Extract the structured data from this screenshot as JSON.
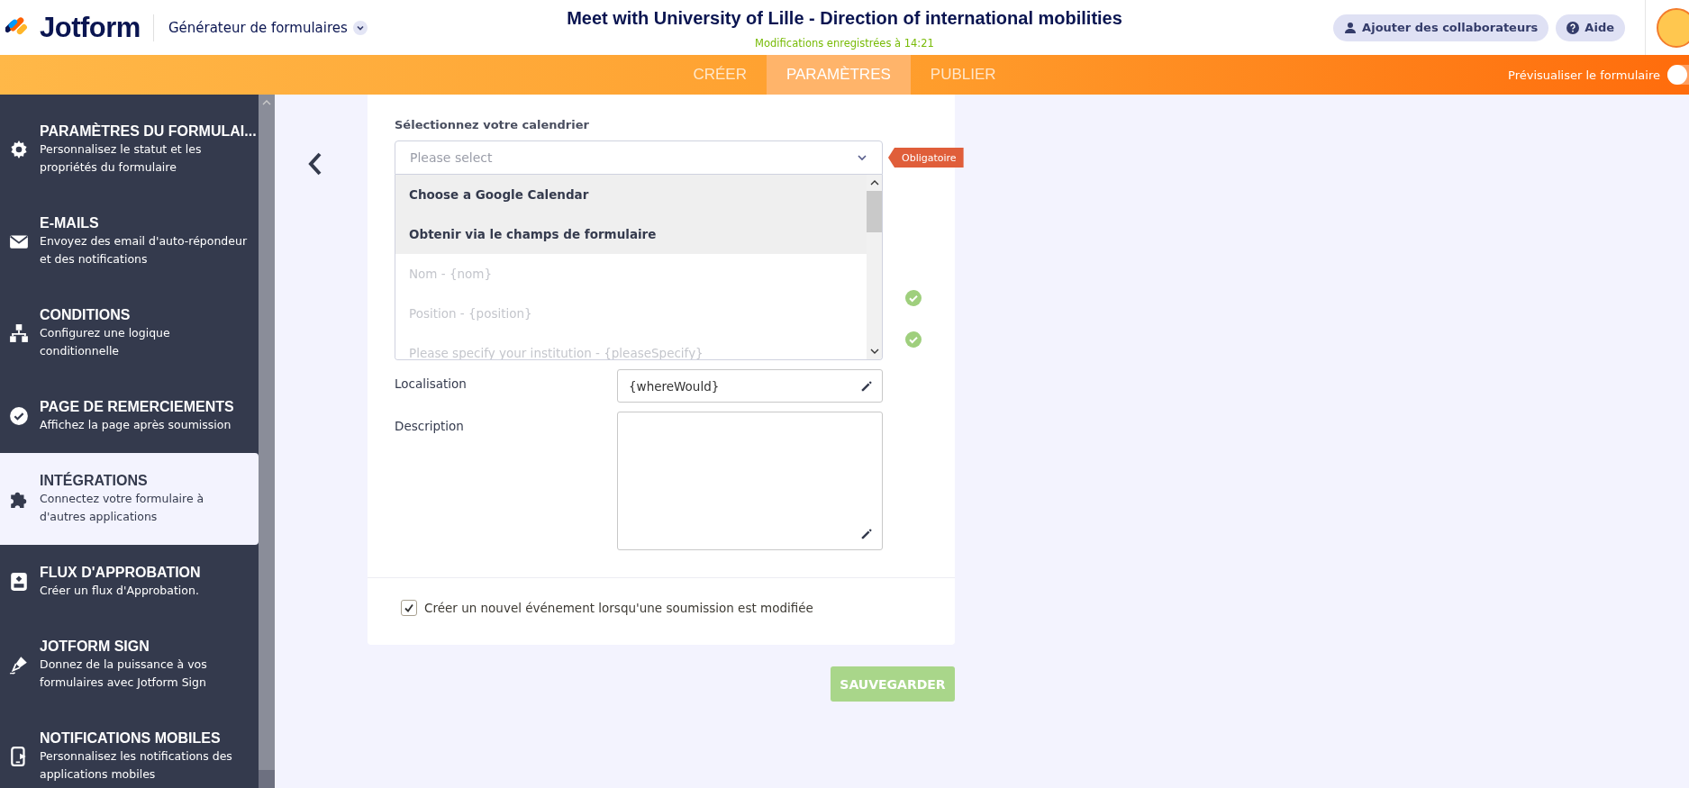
{
  "header": {
    "logo": "Jotform",
    "builder_menu": "Générateur de formulaires",
    "form_title": "Meet with University of Lille - Direction of international mobilities",
    "save_status": "Modifications enregistrées à 14:21",
    "buttons": [
      {
        "label": "Ajouter des collaborateurs",
        "kind": "collaborators"
      },
      {
        "label": "Aide",
        "kind": "help"
      }
    ]
  },
  "tabs": [
    {
      "label": "CRÉER",
      "selected": false
    },
    {
      "label": "PARAMÈTRES",
      "selected": true
    },
    {
      "label": "PUBLIER",
      "selected": false
    }
  ],
  "preview": {
    "label": "Prévisualiser le formulaire",
    "on": false
  },
  "sidebar": {
    "items": [
      {
        "title": "PARAMÈTRES DU FORMULAI...",
        "description": "Personnalisez le statut et les propriétés du formulaire",
        "kind": "gear",
        "selected": false
      },
      {
        "title": "E-MAILS",
        "description": "Envoyez des email d'auto-répondeur et des notifications",
        "kind": "mail",
        "selected": false
      },
      {
        "title": "CONDITIONS",
        "description": "Configurez une logique conditionnelle",
        "kind": "tree",
        "selected": false
      },
      {
        "title": "PAGE DE REMERCIEMENTS",
        "description": "Affichez la page après soumission",
        "kind": "check",
        "selected": false
      },
      {
        "title": "INTÉGRATIONS",
        "description": "Connectez votre formulaire à d'autres applications",
        "kind": "puzzle",
        "selected": true
      },
      {
        "title": "FLUX D'APPROBATION",
        "description": "Créer un flux d'Approbation.",
        "kind": "flow",
        "selected": false
      },
      {
        "title": "JOTFORM SIGN",
        "description": "Donnez de la puissance à vos formulaires avec Jotform Sign",
        "kind": "pen",
        "selected": false
      },
      {
        "title": "NOTIFICATIONS MOBILES",
        "description": "Personnalisez les notifications des applications mobiles",
        "kind": "phone",
        "selected": false
      }
    ]
  },
  "calendar": {
    "label": "Sélectionnez votre calendrier",
    "placeholder": "Please select",
    "required_tag": "Obligatoire",
    "options": [
      {
        "label": "Choose a Google Calendar",
        "disabled": false
      },
      {
        "label": "Obtenir via le champs de formulaire",
        "disabled": false
      },
      {
        "label": "Nom - {nom}",
        "disabled": true
      },
      {
        "label": "Position - {position}",
        "disabled": true
      },
      {
        "label": "Please specify your institution - {pleaseSpecify}",
        "disabled": true
      }
    ]
  },
  "field_status": [
    {
      "valid": true
    },
    {
      "valid": true
    }
  ],
  "fields": [
    {
      "label": "Localisation",
      "value": "{whereWould}",
      "kind": "input"
    },
    {
      "label": "Description",
      "kind": "textarea"
    }
  ],
  "checkbox": {
    "label": "Créer un nouvel événement lorsqu'une soumission est modifiée",
    "checked": true
  },
  "save_button": {
    "label": "SAUVEGARDER",
    "disabled": true
  }
}
